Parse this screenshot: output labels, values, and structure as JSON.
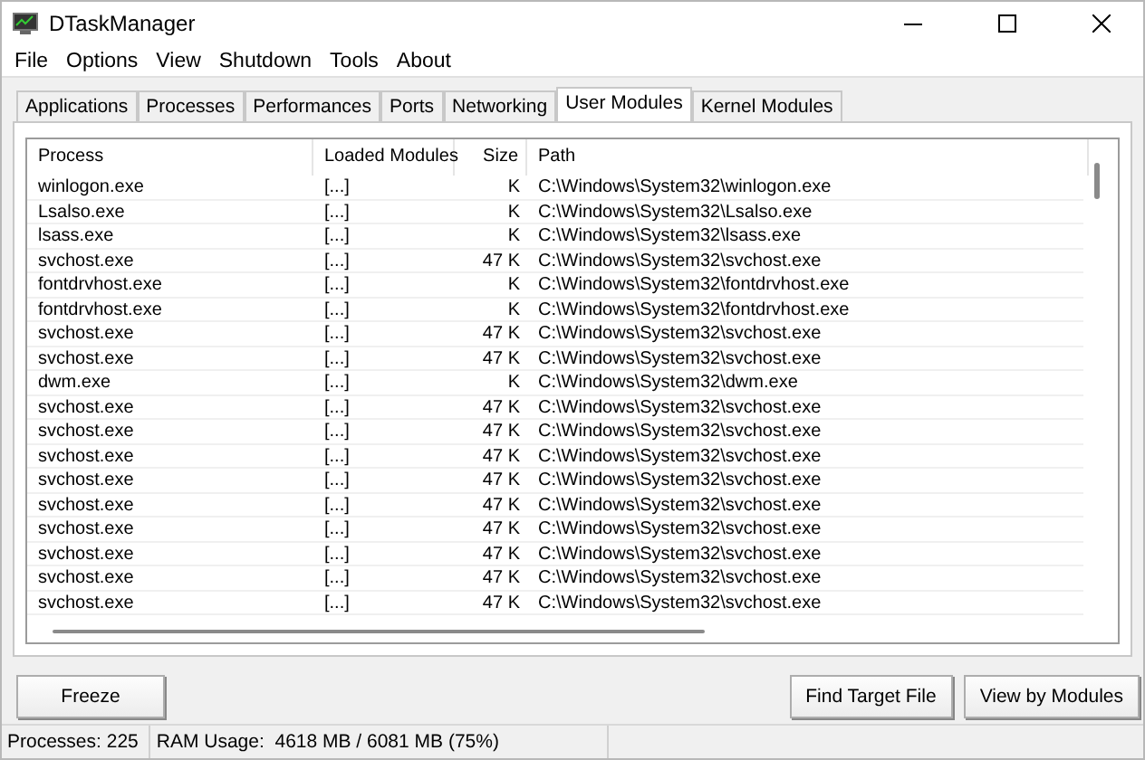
{
  "window": {
    "title": "DTaskManager"
  },
  "menu": [
    "File",
    "Options",
    "View",
    "Shutdown",
    "Tools",
    "About"
  ],
  "tabs": [
    {
      "label": "Applications",
      "selected": false
    },
    {
      "label": "Processes",
      "selected": false
    },
    {
      "label": "Performances",
      "selected": false
    },
    {
      "label": "Ports",
      "selected": false
    },
    {
      "label": "Networking",
      "selected": false
    },
    {
      "label": "User Modules",
      "selected": true
    },
    {
      "label": "Kernel Modules",
      "selected": false
    }
  ],
  "table": {
    "columns": [
      "Process",
      "Loaded Modules",
      "Size",
      "Path"
    ],
    "rows": [
      [
        "winlogon.exe",
        "[...]",
        "K",
        "C:\\Windows\\System32\\winlogon.exe"
      ],
      [
        "Lsalso.exe",
        "[...]",
        "K",
        "C:\\Windows\\System32\\Lsalso.exe"
      ],
      [
        "lsass.exe",
        "[...]",
        "K",
        "C:\\Windows\\System32\\lsass.exe"
      ],
      [
        "svchost.exe",
        "[...]",
        "47 K",
        "C:\\Windows\\System32\\svchost.exe"
      ],
      [
        "fontdrvhost.exe",
        "[...]",
        "K",
        "C:\\Windows\\System32\\fontdrvhost.exe"
      ],
      [
        "fontdrvhost.exe",
        "[...]",
        "K",
        "C:\\Windows\\System32\\fontdrvhost.exe"
      ],
      [
        "svchost.exe",
        "[...]",
        "47 K",
        "C:\\Windows\\System32\\svchost.exe"
      ],
      [
        "svchost.exe",
        "[...]",
        "47 K",
        "C:\\Windows\\System32\\svchost.exe"
      ],
      [
        "dwm.exe",
        "[...]",
        "K",
        "C:\\Windows\\System32\\dwm.exe"
      ],
      [
        "svchost.exe",
        "[...]",
        "47 K",
        "C:\\Windows\\System32\\svchost.exe"
      ],
      [
        "svchost.exe",
        "[...]",
        "47 K",
        "C:\\Windows\\System32\\svchost.exe"
      ],
      [
        "svchost.exe",
        "[...]",
        "47 K",
        "C:\\Windows\\System32\\svchost.exe"
      ],
      [
        "svchost.exe",
        "[...]",
        "47 K",
        "C:\\Windows\\System32\\svchost.exe"
      ],
      [
        "svchost.exe",
        "[...]",
        "47 K",
        "C:\\Windows\\System32\\svchost.exe"
      ],
      [
        "svchost.exe",
        "[...]",
        "47 K",
        "C:\\Windows\\System32\\svchost.exe"
      ],
      [
        "svchost.exe",
        "[...]",
        "47 K",
        "C:\\Windows\\System32\\svchost.exe"
      ],
      [
        "svchost.exe",
        "[...]",
        "47 K",
        "C:\\Windows\\System32\\svchost.exe"
      ],
      [
        "svchost.exe",
        "[...]",
        "47 K",
        "C:\\Windows\\System32\\svchost.exe"
      ]
    ]
  },
  "buttons_left": [
    "Freeze"
  ],
  "buttons_right": [
    "Find Target File",
    "View by Modules"
  ],
  "status_bar": [
    "Processes: 225",
    "RAM Usage:  4618 MB / 6081 MB (75%)"
  ]
}
